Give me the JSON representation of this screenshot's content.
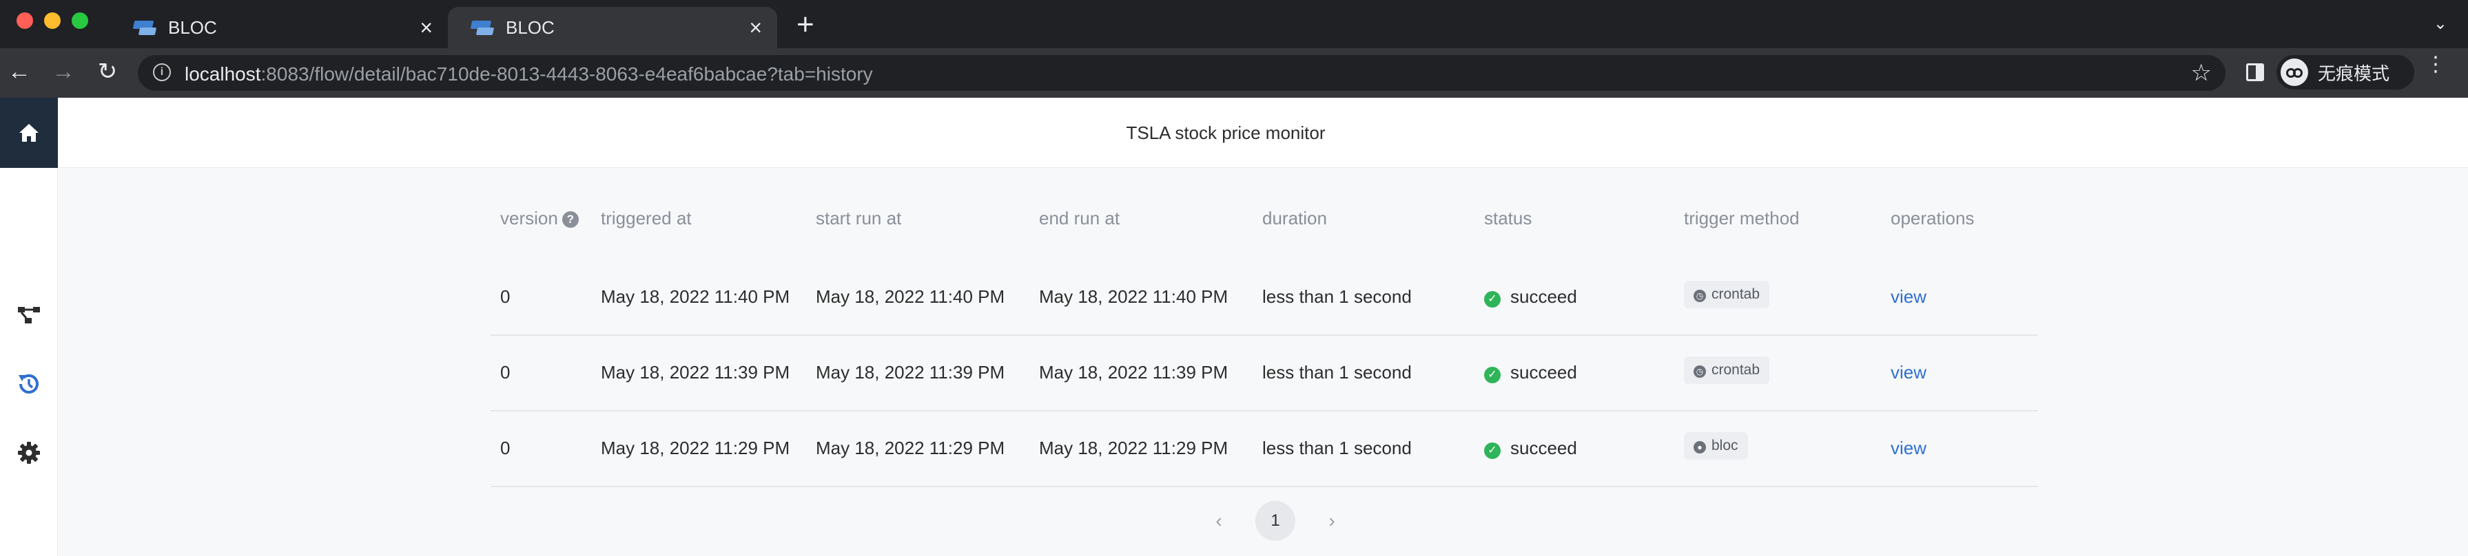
{
  "browser": {
    "tabs": [
      {
        "title": "BLOC",
        "close": "×"
      },
      {
        "title": "BLOC",
        "close": "×"
      }
    ],
    "new_tab": "+",
    "tabs_menu": "⌄",
    "nav": {
      "back": "←",
      "forward": "→",
      "reload": "↻"
    },
    "url_host": "localhost",
    "url_rest": ":8083/flow/detail/bac710de-8013-4443-8063-e4eaf6babcae?tab=history",
    "info_icon": "i",
    "star": "☆",
    "incognito_label": "无痕模式",
    "menu": "⋮"
  },
  "app": {
    "title": "TSLA stock price monitor",
    "sidebar": [
      "home-icon",
      "flow-icon",
      "history-icon",
      "settings-icon"
    ],
    "accent_color": "#2f6fd0",
    "table": {
      "headers": {
        "version": "version",
        "help": "?",
        "triggered_at": "triggered at",
        "start_run_at": "start run at",
        "end_run_at": "end run at",
        "duration": "duration",
        "status": "status",
        "trigger_method": "trigger method",
        "operations": "operations"
      },
      "rows": [
        {
          "version": "0",
          "triggered_at": "May 18, 2022 11:40 PM",
          "start_run_at": "May 18, 2022 11:40 PM",
          "end_run_at": "May 18, 2022 11:40 PM",
          "duration": "less than 1 second",
          "status_icon": "✓",
          "status": "succeed",
          "method_icon": "clock-icon",
          "method": "crontab",
          "op": "view"
        },
        {
          "version": "0",
          "triggered_at": "May 18, 2022 11:39 PM",
          "start_run_at": "May 18, 2022 11:39 PM",
          "end_run_at": "May 18, 2022 11:39 PM",
          "duration": "less than 1 second",
          "status_icon": "✓",
          "status": "succeed",
          "method_icon": "clock-icon",
          "method": "crontab",
          "op": "view"
        },
        {
          "version": "0",
          "triggered_at": "May 18, 2022 11:29 PM",
          "start_run_at": "May 18, 2022 11:29 PM",
          "end_run_at": "May 18, 2022 11:29 PM",
          "duration": "less than 1 second",
          "status_icon": "✓",
          "status": "succeed",
          "method_icon": "user-icon",
          "method": "bloc",
          "op": "view"
        }
      ]
    },
    "pagination": {
      "prev": "‹",
      "current": "1",
      "next": "›"
    }
  }
}
